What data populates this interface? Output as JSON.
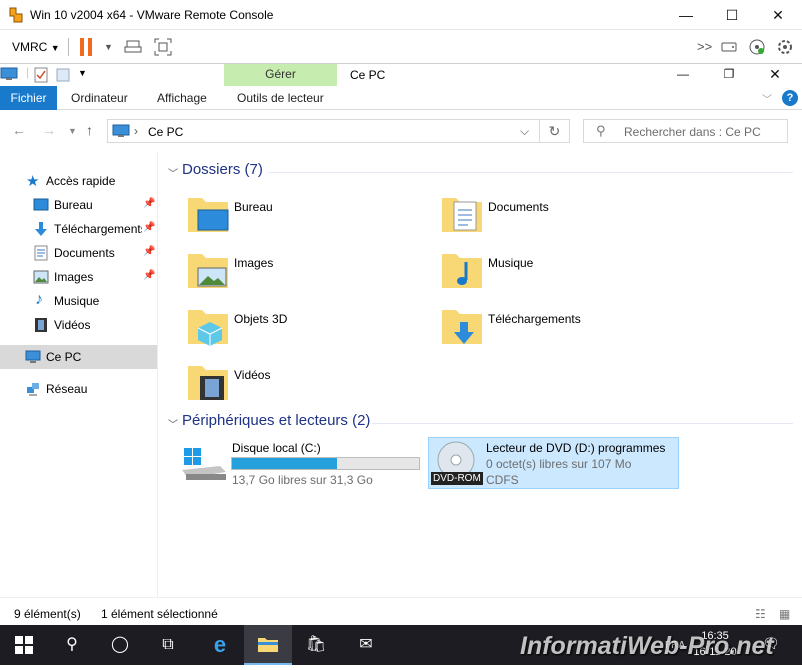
{
  "vmrc": {
    "title": "Win 10 v2004 x64 - VMware Remote Console",
    "menu_label": "VMRC",
    "controls": {
      "minimize": "—",
      "maximize": "☐",
      "close": "✕"
    }
  },
  "explorer": {
    "title": "Ce PC",
    "contextual_tab_group": "Gérer",
    "tabs": [
      "Fichier",
      "Ordinateur",
      "Affichage",
      "Outils de lecteur"
    ],
    "address": "Ce PC",
    "search_placeholder": "Rechercher dans : Ce PC"
  },
  "nav": {
    "quick_access": "Accès rapide",
    "items": [
      {
        "label": "Bureau",
        "icon": "desktop-icon"
      },
      {
        "label": "Téléchargements",
        "icon": "downloads-icon"
      },
      {
        "label": "Documents",
        "icon": "documents-icon"
      },
      {
        "label": "Images",
        "icon": "pictures-icon"
      },
      {
        "label": "Musique",
        "icon": "music-icon"
      },
      {
        "label": "Vidéos",
        "icon": "videos-icon"
      }
    ],
    "this_pc": "Ce PC",
    "network": "Réseau"
  },
  "main": {
    "folders_header": "Dossiers (7)",
    "folders": [
      "Bureau",
      "Documents",
      "Images",
      "Musique",
      "Objets 3D",
      "Téléchargements",
      "Vidéos"
    ],
    "devices_header": "Périphériques et lecteurs (2)",
    "drives": [
      {
        "name": "Disque local (C:)",
        "free": "13,7 Go libres sur 31,3 Go",
        "used_fraction": 0.56
      },
      {
        "name": "Lecteur de DVD (D:) programmes",
        "free": "0 octet(s) libres sur 107 Mo",
        "fs": "CDFS",
        "badge": "DVD-ROM"
      }
    ]
  },
  "status": {
    "count": "9 élément(s)",
    "selected": "1 élément sélectionné"
  },
  "taskbar": {
    "time": "16:35",
    "date": "16-11-20",
    "watermark": "InformatiWeb-Pro.net",
    "lang": "FRA"
  },
  "colors": {
    "accent": "#1979ca",
    "manage_tab": "#c6ecb0",
    "selection": "#cce8ff",
    "progress": "#26a0da",
    "folder": "#f8d775"
  }
}
